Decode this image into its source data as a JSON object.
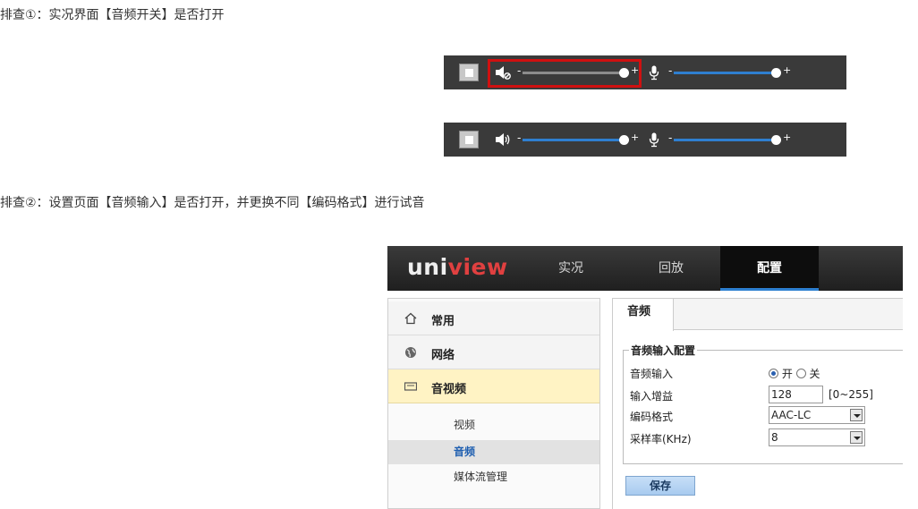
{
  "step1": {
    "text": "排查①：实况界面【音频开关】是否打开"
  },
  "step2": {
    "text": "排查②：设置页面【音频输入】是否打开，并更换不同【编码格式】进行试音"
  },
  "toolbar1": {
    "minus_a": "-",
    "plus_a": "+",
    "minus_b": "-",
    "plus_b": "+",
    "speaker_icon": "speaker-muted-icon",
    "speaker_level": 0.91,
    "mic_level": 0.94,
    "highlight_color": "#d01010"
  },
  "toolbar2": {
    "minus_a": "-",
    "plus_a": "+",
    "minus_b": "-",
    "plus_b": "+",
    "speaker_icon": "speaker-on-icon",
    "speaker_level": 0.91,
    "mic_level": 0.94,
    "slider_color": "#2f7fd0"
  },
  "nav": {
    "logo_a": "uni",
    "logo_b": "view",
    "tabs": [
      "实况",
      "回放",
      "配置"
    ],
    "active_tab": "配置"
  },
  "sidebar": {
    "items": [
      {
        "label": "常用",
        "icon": "home-icon"
      },
      {
        "label": "网络",
        "icon": "globe-icon"
      },
      {
        "label": "音视频",
        "icon": "monitor-icon"
      }
    ],
    "sub_items": [
      "视频",
      "音频",
      "媒体流管理"
    ],
    "active_sub": "音频"
  },
  "content": {
    "tab": "音频",
    "legend": "音频输入配置",
    "rows": {
      "input_label": "音频输入",
      "input_on": "开",
      "input_off": "关",
      "gain_label": "输入增益",
      "gain_value": "128",
      "gain_range": "[0~255]",
      "codec_label": "编码格式",
      "codec_value": "AAC-LC",
      "rate_label": "采样率(KHz)",
      "rate_value": "8"
    },
    "save_label": "保存"
  }
}
